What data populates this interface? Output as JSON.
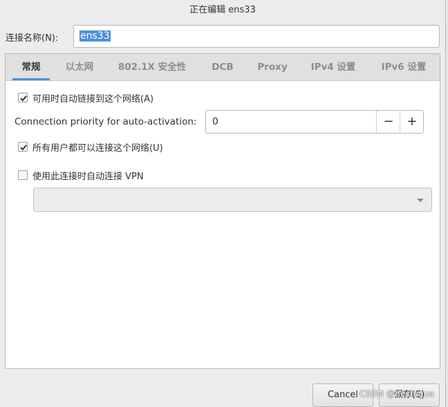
{
  "window": {
    "title": "正在编辑 ens33"
  },
  "connection": {
    "name_label": "连接名称(N):",
    "name_value": "ens33"
  },
  "tabs": [
    {
      "label": "常规",
      "active": true
    },
    {
      "label": "以太网",
      "active": false
    },
    {
      "label": "802.1X 安全性",
      "active": false
    },
    {
      "label": "DCB",
      "active": false
    },
    {
      "label": "Proxy",
      "active": false
    },
    {
      "label": "IPv4 设置",
      "active": false
    },
    {
      "label": "IPv6 设置",
      "active": false
    }
  ],
  "general": {
    "auto_connect": {
      "label": "可用时自动链接到这个网络(A)",
      "checked": true
    },
    "priority": {
      "label": "Connection priority for auto-activation:",
      "value": "0",
      "decrement": "−",
      "increment": "+"
    },
    "all_users": {
      "label": "所有用户都可以连接这个网络(U)",
      "checked": true
    },
    "vpn": {
      "label": "使用此连接时自动连接 VPN",
      "checked": false,
      "selected": ""
    }
  },
  "buttons": {
    "cancel": "Cancel",
    "save": "保存(S)"
  },
  "watermark": "CSDN @hexiugua",
  "colors": {
    "accent": "#4a90d9"
  }
}
